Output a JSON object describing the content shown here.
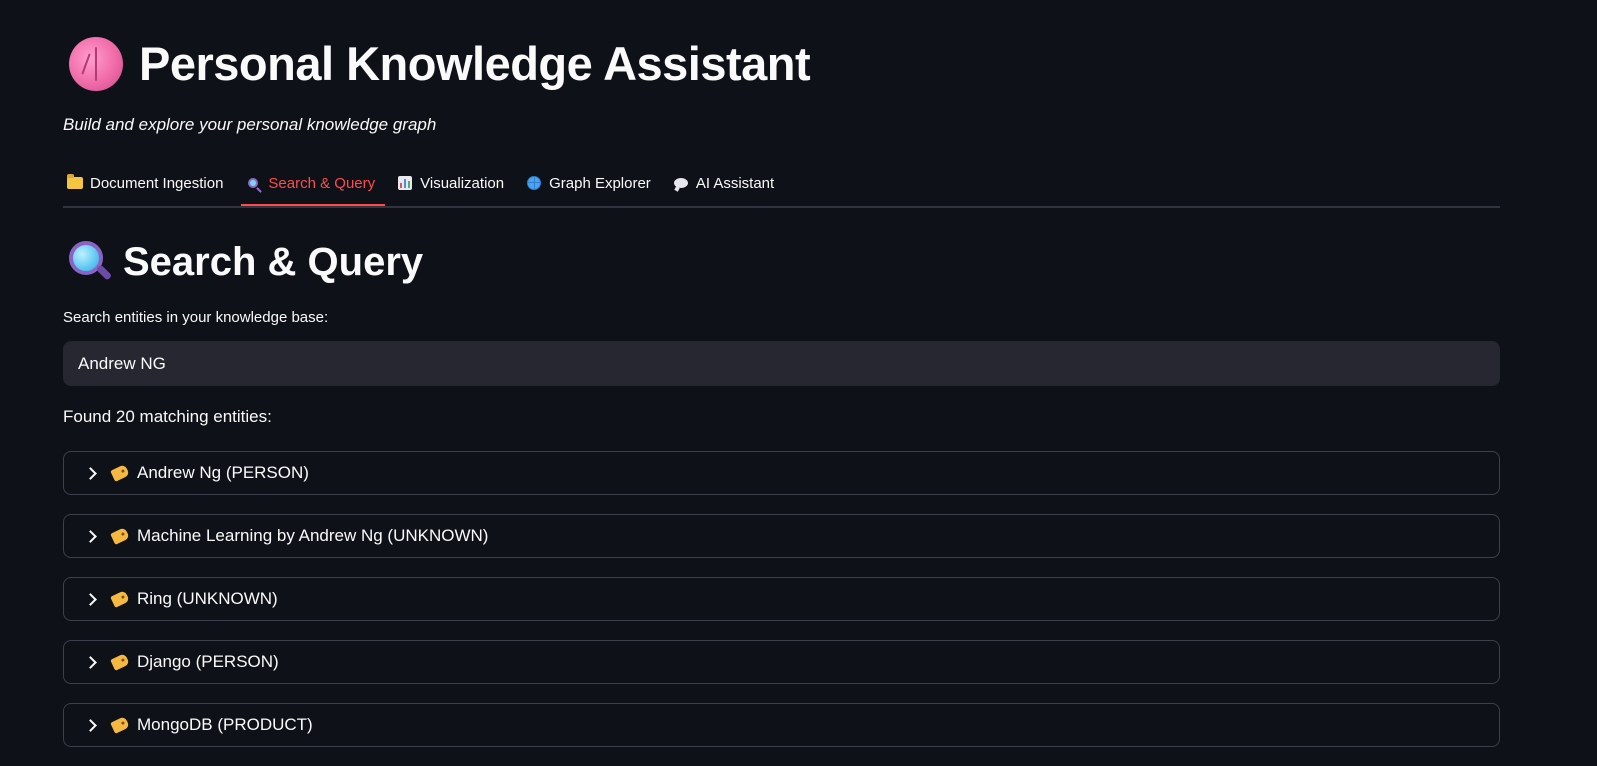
{
  "header": {
    "title": "Personal Knowledge Assistant",
    "title_icon": "brain-icon",
    "subtitle": "Build and explore your personal knowledge graph"
  },
  "tabs": [
    {
      "label": "Document Ingestion",
      "icon": "folder-icon",
      "active": false
    },
    {
      "label": "Search & Query",
      "icon": "magnifier-icon",
      "active": true
    },
    {
      "label": "Visualization",
      "icon": "bar-chart-icon",
      "active": false
    },
    {
      "label": "Graph Explorer",
      "icon": "globe-icon",
      "active": false
    },
    {
      "label": "AI Assistant",
      "icon": "speech-bubble-icon",
      "active": false
    }
  ],
  "section": {
    "title": "Search & Query",
    "icon": "magnifier-icon"
  },
  "search": {
    "label": "Search entities in your knowledge base:",
    "value": "Andrew NG"
  },
  "results": {
    "summary": "Found 20 matching entities:",
    "items": [
      {
        "label": "Andrew Ng (PERSON)",
        "icon": "tag-icon"
      },
      {
        "label": "Machine Learning by Andrew Ng (UNKNOWN)",
        "icon": "tag-icon"
      },
      {
        "label": "Ring (UNKNOWN)",
        "icon": "tag-icon"
      },
      {
        "label": "Django (PERSON)",
        "icon": "tag-icon"
      },
      {
        "label": "MongoDB (PRODUCT)",
        "icon": "tag-icon"
      }
    ]
  },
  "colors": {
    "background": "#0e1117",
    "active_tab": "#ff4b4b",
    "input_background": "#262730",
    "border": "#3d3f4b"
  }
}
